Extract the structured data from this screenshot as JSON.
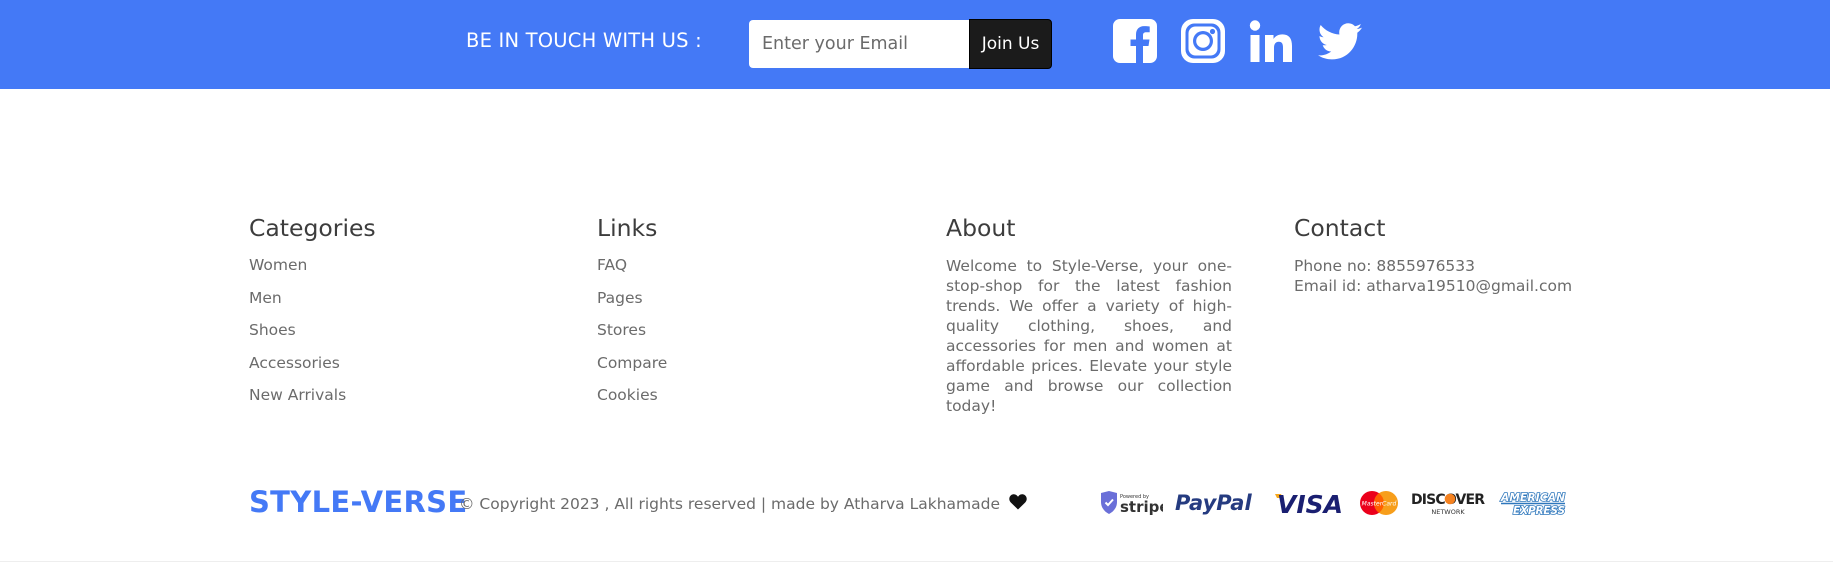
{
  "newsletter": {
    "title": "BE IN TOUCH WITH US :",
    "email_placeholder": "Enter your Email",
    "join_label": "Join Us",
    "social": [
      "facebook-icon",
      "instagram-icon",
      "linkedin-icon",
      "twitter-icon"
    ]
  },
  "columns": {
    "categories": {
      "heading": "Categories",
      "items": [
        "Women",
        "Men",
        "Shoes",
        "Accessories",
        "New Arrivals"
      ]
    },
    "links": {
      "heading": "Links",
      "items": [
        "FAQ",
        "Pages",
        "Stores",
        "Compare",
        "Cookies"
      ]
    },
    "about": {
      "heading": "About",
      "text": "Welcome to Style-Verse, your one-stop-shop for the latest fashion trends. We offer a variety of high-quality clothing, shoes, and accessories for men and women at affordable prices. Elevate your style game and browse our collection today!"
    },
    "contact": {
      "heading": "Contact",
      "phone": "Phone no: 8855976533",
      "email": "Email id: atharva19510@gmail.com"
    }
  },
  "bottom": {
    "brand": "STYLE-VERSE",
    "copyright": "© Copyright 2023 , All rights reserved | made by Atharva Lakhamade",
    "payments": {
      "stripe_small": "Powered by",
      "stripe": "stripe",
      "paypal": "PayPal",
      "visa": "VISA",
      "mastercard": "MasterCard",
      "discover": "DISCOVER",
      "discover_sub": "NETWORK",
      "amex_top": "AMERICAN",
      "amex_bottom": "EXPRESS"
    }
  },
  "colors": {
    "brand_blue": "#4479f6",
    "button_dark": "#1b1b1b",
    "text_gray": "#6b6b6b"
  }
}
